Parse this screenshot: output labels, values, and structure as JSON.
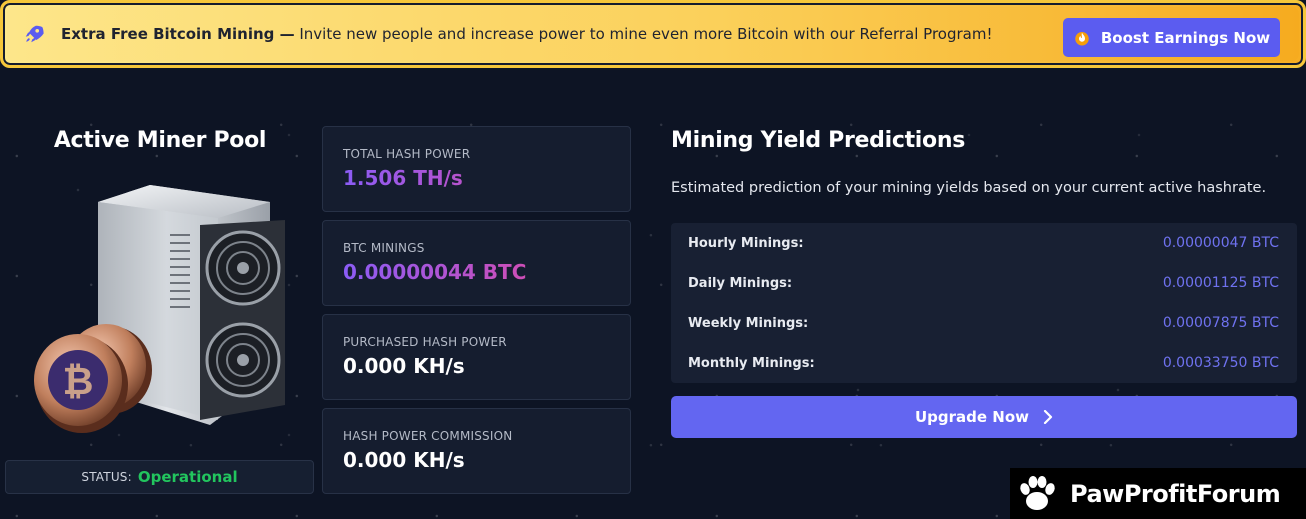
{
  "banner": {
    "title": "Extra Free Bitcoin Mining —",
    "message": " Invite new people and increase power to mine even more Bitcoin with our Referral Program!",
    "button_label": "Boost Earnings Now",
    "rocket_icon": "rocket-icon",
    "fire_icon": "fire-icon"
  },
  "pool": {
    "title": "Active Miner Pool",
    "status_label": "STATUS:",
    "status_value": "Operational"
  },
  "stats": [
    {
      "label": "TOTAL HASH POWER",
      "value": "1.506 TH/s"
    },
    {
      "label": "BTC MININGS",
      "value": "0.00000044 BTC"
    },
    {
      "label": "PURCHASED HASH POWER",
      "value": "0.000 KH/s"
    },
    {
      "label": "HASH POWER COMMISSION",
      "value": "0.000 KH/s"
    }
  ],
  "yield": {
    "title": "Mining Yield Predictions",
    "description": "Estimated prediction of your mining yields based on your current active hashrate.",
    "rows": [
      {
        "label": "Hourly Minings:",
        "value": "0.00000047 BTC"
      },
      {
        "label": "Daily Minings:",
        "value": "0.00001125 BTC"
      },
      {
        "label": "Weekly Minings:",
        "value": "0.00007875 BTC"
      },
      {
        "label": "Monthly Minings:",
        "value": "0.00033750 BTC"
      }
    ],
    "button_label": "Upgrade Now"
  },
  "watermark": {
    "text": "PawProfitForum"
  },
  "colors": {
    "accent": "#6366f1",
    "status_green": "#22c55e",
    "banner_yellow": "#fbd05a"
  }
}
